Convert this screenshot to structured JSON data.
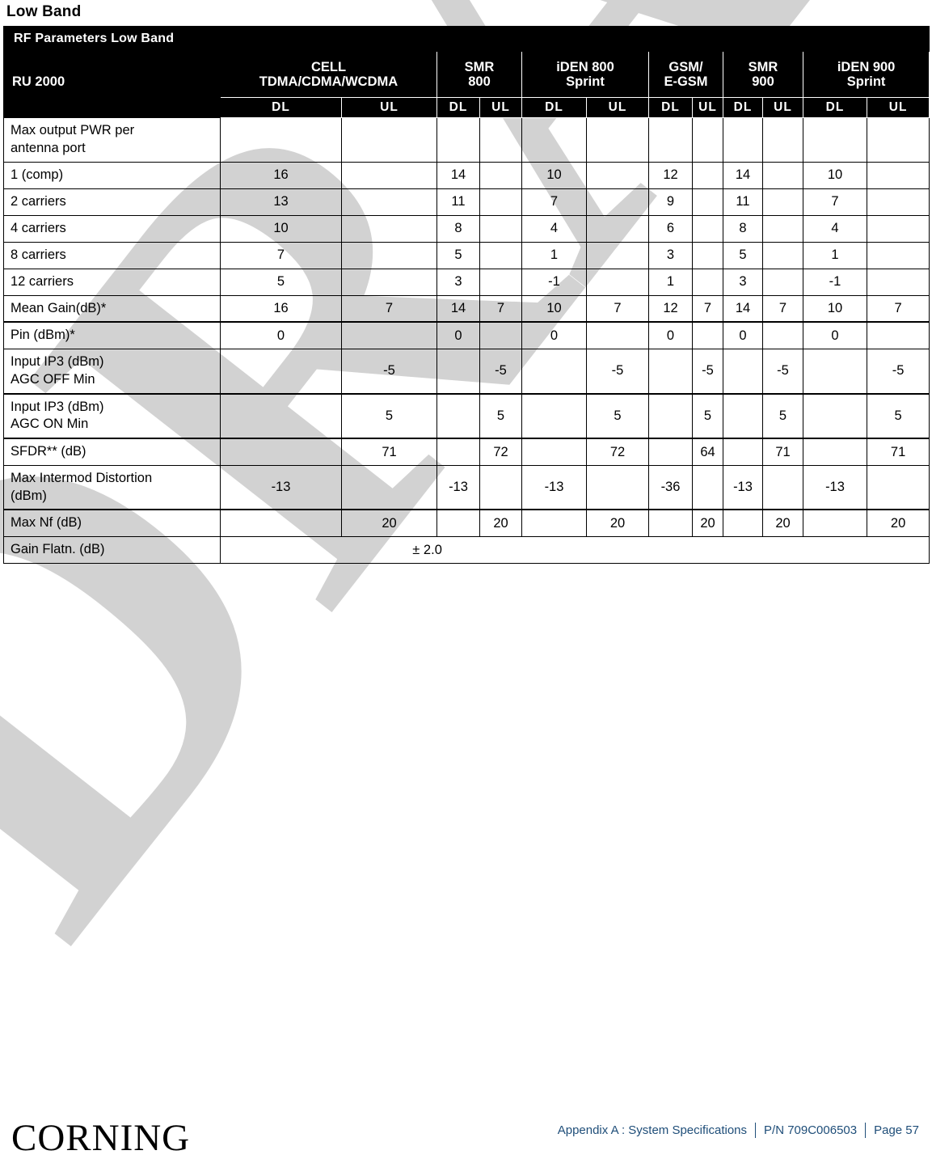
{
  "section": {
    "title": "Low Band"
  },
  "table": {
    "banner": "RF Parameters Low Band",
    "corner_label": "RU 2000",
    "groups": [
      {
        "name": "CELL\nTDMA/CDMA/WCDMA",
        "line1": "CELL",
        "line2": "TDMA/CDMA/WCDMA"
      },
      {
        "name": "SMR 800",
        "line1": "SMR",
        "line2": "800"
      },
      {
        "name": "iDEN 800 Sprint",
        "line1": "iDEN 800",
        "line2": "Sprint"
      },
      {
        "name": "GSM/E-GSM",
        "line1": "GSM/",
        "line2": "E-GSM"
      },
      {
        "name": "SMR 900",
        "line1": "SMR",
        "line2": "900"
      },
      {
        "name": "iDEN 900 Sprint",
        "line1": "iDEN 900",
        "line2": "Sprint"
      }
    ],
    "sub_headers": [
      "DL",
      "UL",
      "DL",
      "UL",
      "DL",
      "UL",
      "DL",
      "UL",
      "DL",
      "UL",
      "DL",
      "UL"
    ],
    "rows": [
      {
        "label": "Max output PWR per\nantenna port",
        "label_l1": "Max output PWR per",
        "label_l2": "antenna port",
        "cells": [
          "",
          "",
          "",
          "",
          "",
          "",
          "",
          "",
          "",
          "",
          "",
          ""
        ]
      },
      {
        "label": "1 (comp)",
        "cells": [
          "16",
          "",
          "14",
          "",
          "10",
          "",
          "12",
          "",
          "14",
          "",
          "10",
          ""
        ]
      },
      {
        "label": "2 carriers",
        "cells": [
          "13",
          "",
          "11",
          "",
          "7",
          "",
          "9",
          "",
          "11",
          "",
          "7",
          ""
        ]
      },
      {
        "label": "4 carriers",
        "cells": [
          "10",
          "",
          "8",
          "",
          "4",
          "",
          "6",
          "",
          "8",
          "",
          "4",
          ""
        ]
      },
      {
        "label": "8 carriers",
        "cells": [
          "7",
          "",
          "5",
          "",
          "1",
          "",
          "3",
          "",
          "5",
          "",
          "1",
          ""
        ]
      },
      {
        "label": "12 carriers",
        "cells": [
          "5",
          "",
          "3",
          "",
          "-1",
          "",
          "1",
          "",
          "3",
          "",
          "-1",
          ""
        ]
      },
      {
        "label": "Mean Gain(dB)*",
        "cells": [
          "16",
          "7",
          "14",
          "7",
          "10",
          "7",
          "12",
          "7",
          "14",
          "7",
          "10",
          "7"
        ]
      },
      {
        "label": "Pin (dBm)*",
        "cells": [
          "0",
          "",
          "0",
          "",
          "0",
          "",
          "0",
          "",
          "0",
          "",
          "0",
          ""
        ]
      },
      {
        "label": "Input IP3 (dBm)\nAGC OFF Min",
        "label_l1": "Input IP3 (dBm)",
        "label_l2": "AGC OFF Min",
        "cells": [
          "",
          "-5",
          "",
          "-5",
          "",
          "-5",
          "",
          "-5",
          "",
          "-5",
          "",
          "-5"
        ]
      },
      {
        "label": "Input IP3 (dBm)\nAGC ON Min",
        "label_l1": "Input IP3 (dBm)",
        "label_l2": "AGC ON Min",
        "cells": [
          "",
          "5",
          "",
          "5",
          "",
          "5",
          "",
          "5",
          "",
          "5",
          "",
          "5"
        ]
      },
      {
        "label": "SFDR** (dB)",
        "cells": [
          "",
          "71",
          "",
          "72",
          "",
          "72",
          "",
          "64",
          "",
          "71",
          "",
          "71"
        ]
      },
      {
        "label": "Max Intermod Distortion\n(dBm)",
        "label_l1": "Max Intermod Distortion",
        "label_l2": "(dBm)",
        "cells": [
          "-13",
          "",
          "-13",
          "",
          "-13",
          "",
          "-36",
          "",
          "-13",
          "",
          "-13",
          ""
        ]
      },
      {
        "label": "Max Nf (dB)",
        "cells": [
          "",
          "20",
          "",
          "20",
          "",
          "20",
          "",
          "20",
          "",
          "20",
          "",
          "20"
        ]
      },
      {
        "label": "Gain Flatn. (dB)",
        "span_value": "± 2.0",
        "cells": []
      }
    ]
  },
  "watermark": {
    "text": "DRAFT",
    "color": "#d0d0d0"
  },
  "footer": {
    "logo": "CORNING",
    "appendix": "Appendix A : System Specifications",
    "part_number": "P/N 709C006503",
    "page": "Page 57",
    "link_color": "#1f4e79"
  }
}
